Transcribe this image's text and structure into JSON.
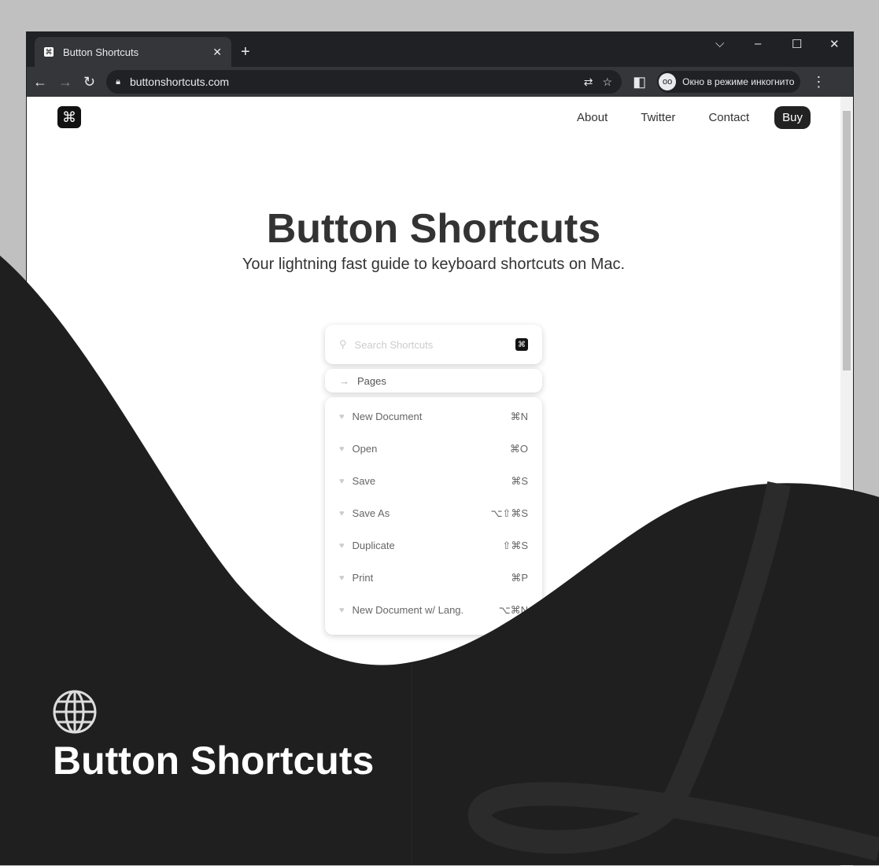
{
  "browser": {
    "tab_title": "Button Shortcuts",
    "url": "buttonshortcuts.com",
    "incognito_label": "Окно в режиме инкогнито"
  },
  "site": {
    "nav": [
      "About",
      "Twitter",
      "Contact"
    ],
    "buy": "Buy",
    "title": "Button Shortcuts",
    "subtitle": "Your lightning fast guide to keyboard shortcuts on Mac.",
    "search_placeholder": "Search Shortcuts",
    "pages_label": "Pages",
    "shortcuts": [
      {
        "name": "New Document",
        "keys": "⌘N"
      },
      {
        "name": "Open",
        "keys": "⌘O"
      },
      {
        "name": "Save",
        "keys": "⌘S"
      },
      {
        "name": "Save As",
        "keys": "⌥⇧⌘S"
      },
      {
        "name": "Duplicate",
        "keys": "⇧⌘S"
      },
      {
        "name": "Print",
        "keys": "⌘P"
      },
      {
        "name": "New Document w/ Lang.",
        "keys": "⌥⌘N"
      }
    ]
  },
  "overlay": {
    "title": "Button Shortcuts",
    "icon": "globe-icon"
  }
}
